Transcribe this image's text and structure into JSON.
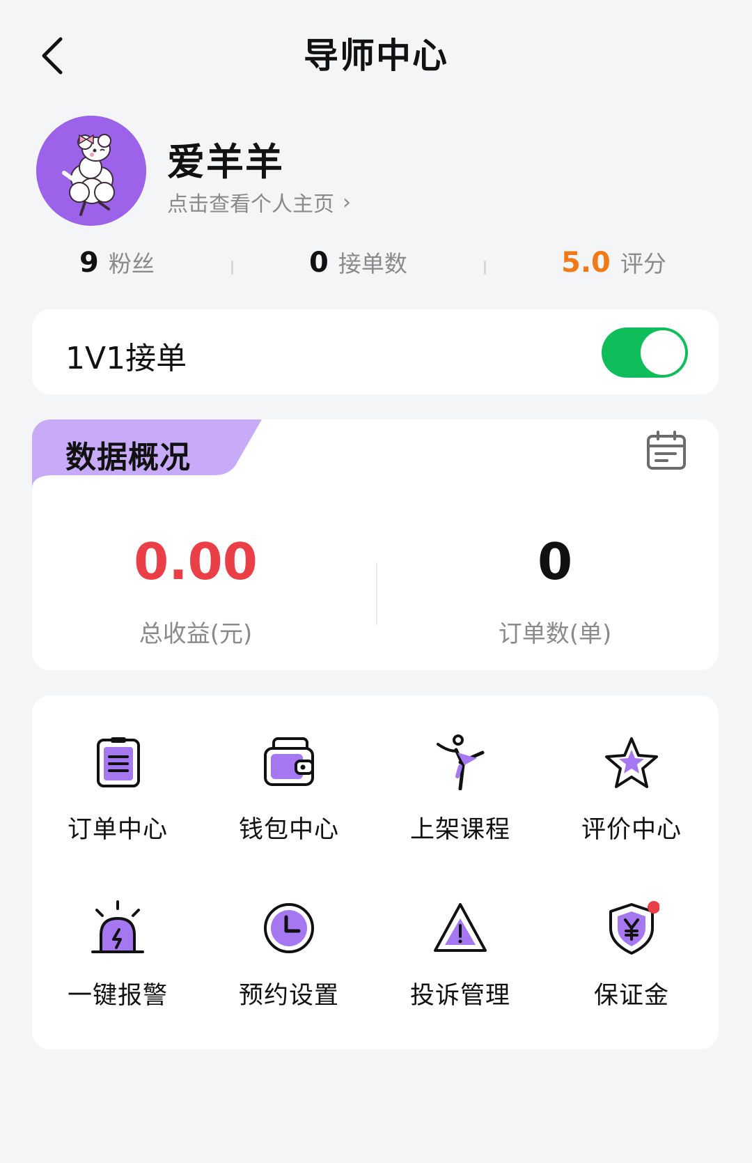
{
  "header": {
    "title": "导师中心"
  },
  "profile": {
    "name": "爱羊羊",
    "link_text": "点击查看个人主页",
    "link_chevron": "›"
  },
  "stats": [
    {
      "value": "9",
      "label": "粉丝"
    },
    {
      "value": "0",
      "label": "接单数"
    },
    {
      "value": "5.0",
      "label": "评分"
    }
  ],
  "one_on_one": {
    "label": "1V1接单",
    "enabled": true
  },
  "overview": {
    "title": "数据概况",
    "earnings": {
      "value": "0.00",
      "label": "总收益(元)"
    },
    "orders": {
      "value": "0",
      "label": "订单数(单)"
    }
  },
  "menu": [
    {
      "label": "订单中心",
      "icon": "clipboard-icon"
    },
    {
      "label": "钱包中心",
      "icon": "wallet-icon"
    },
    {
      "label": "上架课程",
      "icon": "dance-icon"
    },
    {
      "label": "评价中心",
      "icon": "star-icon"
    },
    {
      "label": "一键报警",
      "icon": "alarm-icon"
    },
    {
      "label": "预约设置",
      "icon": "clock-icon"
    },
    {
      "label": "投诉管理",
      "icon": "warning-icon"
    },
    {
      "label": "保证金",
      "icon": "shield-yen-icon"
    }
  ],
  "colors": {
    "accent": "#9c63ea",
    "toggle_on": "#0fbd5a",
    "earnings": "#ea3f46",
    "rating": "#f07a17"
  }
}
